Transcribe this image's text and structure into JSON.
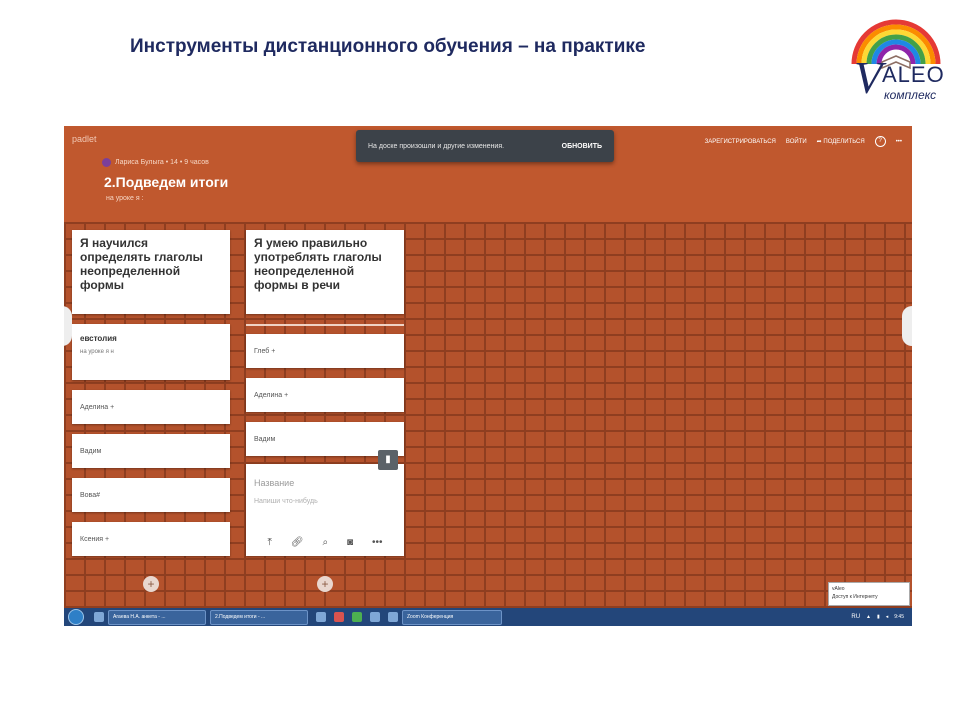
{
  "slide": {
    "title": "Инструменты дистанционного обучения – на практике",
    "logo_main": "V",
    "logo_aleo": "ALEO",
    "logo_sub": "комплекс"
  },
  "padlet": {
    "logo": "padlet",
    "author": "Лариса Булыга • 14 • 9 часов",
    "title": "2.Подведем итоги",
    "subtitle": "на уроке я :",
    "notification": {
      "text": "На доске произошли и другие изменения.",
      "button": "ОБНОВИТЬ"
    },
    "nav": {
      "register": "ЗАРЕГИСТРИРОВАТЬСЯ",
      "login": "ВОЙТИ",
      "share": "ПОДЕЛИТЬСЯ",
      "help": "?",
      "more": "•••"
    },
    "columns": [
      {
        "header": "Я научился определять глаголы неопределенной формы",
        "posts": [
          {
            "name": "евстолия",
            "note": "на уроке я н"
          },
          {
            "name": "Аделина +"
          },
          {
            "name": "Вадим"
          },
          {
            "name": "Вова#"
          },
          {
            "name": "Ксения +"
          }
        ]
      },
      {
        "header": "Я умею правильно употреблять глаголы неопределенной формы в речи",
        "posts": [
          {
            "name": "Глеб +"
          },
          {
            "name": "Аделина +"
          },
          {
            "name": "Вадим"
          }
        ],
        "editor": {
          "title_placeholder": "Название",
          "body_placeholder": "Напиши что-нибудь"
        }
      }
    ],
    "tooltip": {
      "line1": "vAleo",
      "line2": "Доступ к Интернету"
    }
  },
  "taskbar": {
    "items": [
      "Агаева Н.А. анкета - ...",
      "2.Подведем итоги - ...",
      "Zoom Конференция"
    ],
    "lang": "RU",
    "time": "9:45"
  },
  "colors": {
    "brick": "#b4522c",
    "notif_bg": "#3c4249",
    "taskbar": "#23467a",
    "title": "#1f2a60"
  }
}
